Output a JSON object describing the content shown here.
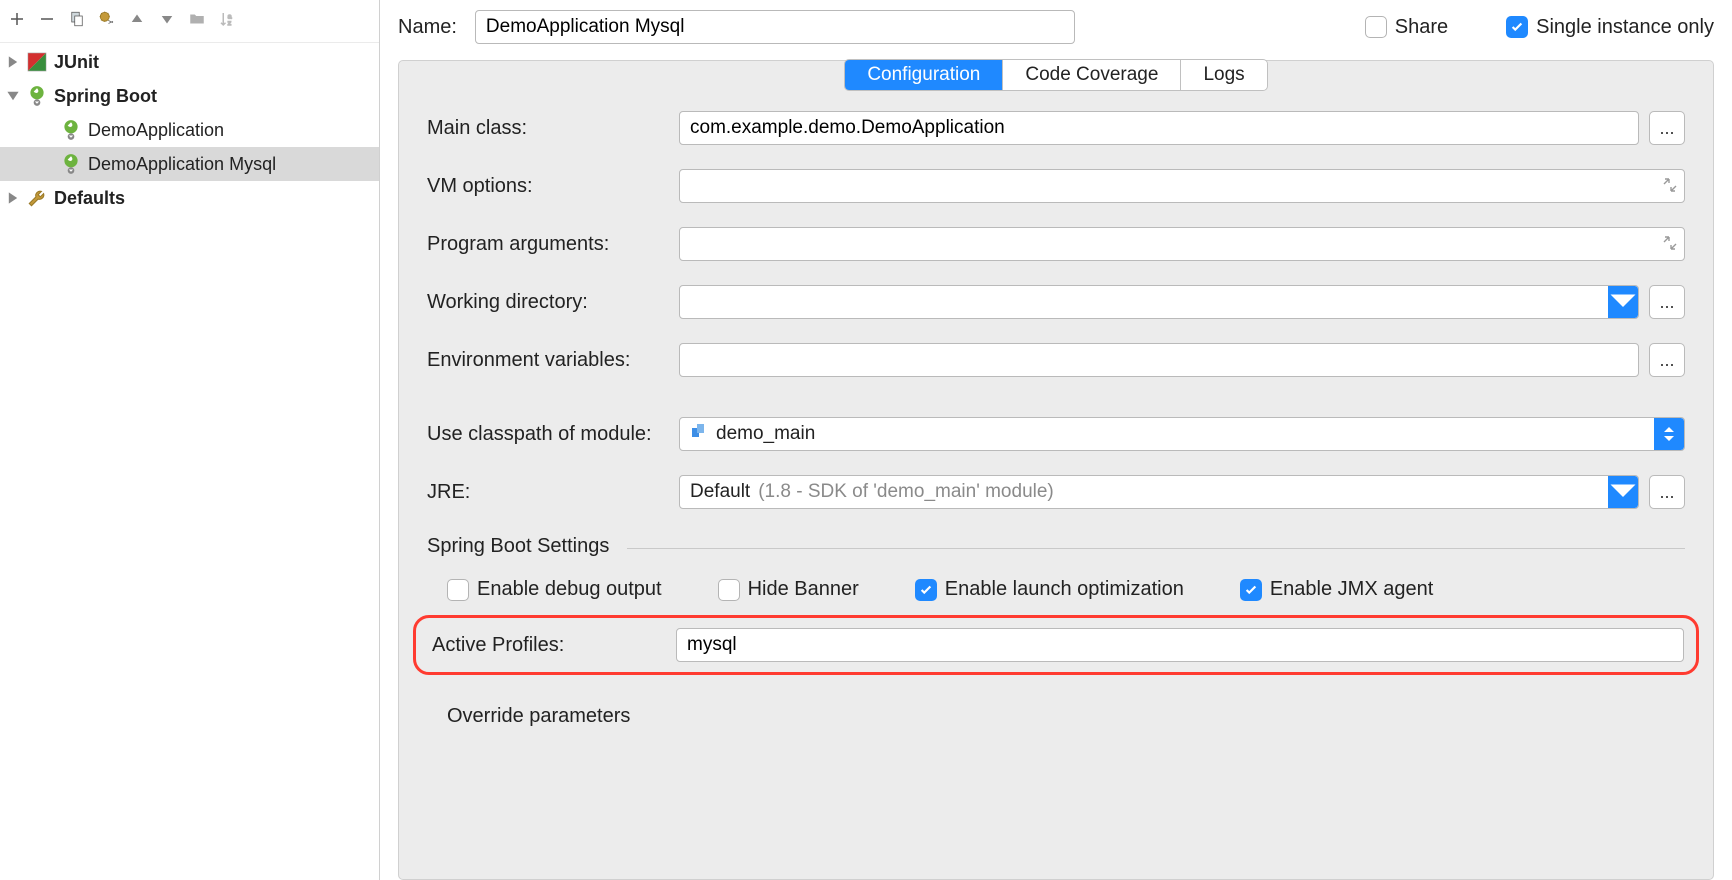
{
  "sidebar": {
    "items": [
      {
        "label": "JUnit",
        "icon": "junit",
        "expandable": true,
        "expanded": false,
        "indent": 0,
        "bold": true
      },
      {
        "label": "Spring Boot",
        "icon": "spring",
        "expandable": true,
        "expanded": true,
        "indent": 0,
        "bold": true
      },
      {
        "label": "DemoApplication",
        "icon": "spring",
        "expandable": false,
        "indent": 1
      },
      {
        "label": "DemoApplication Mysql",
        "icon": "spring",
        "expandable": false,
        "indent": 1,
        "selected": true
      },
      {
        "label": "Defaults",
        "icon": "defaults",
        "expandable": true,
        "expanded": false,
        "indent": 0,
        "bold": true
      }
    ]
  },
  "header": {
    "name_label": "Name:",
    "name_value": "DemoApplication Mysql",
    "share_label": "Share",
    "share_checked": false,
    "single_label": "Single instance only",
    "single_checked": true
  },
  "tabs": [
    "Configuration",
    "Code Coverage",
    "Logs"
  ],
  "active_tab": 0,
  "form": {
    "main_class_label": "Main class:",
    "main_class_value": "com.example.demo.DemoApplication",
    "vm_label": "VM options:",
    "args_label": "Program arguments:",
    "workdir_label": "Working directory:",
    "env_label": "Environment variables:",
    "classpath_label": "Use classpath of module:",
    "classpath_value": "demo_main",
    "jre_label": "JRE:",
    "jre_value": "Default ",
    "jre_hint": "(1.8 - SDK of 'demo_main' module)",
    "sb_section": "Spring Boot Settings",
    "sb_debug": "Enable debug output",
    "sb_hide": "Hide Banner",
    "sb_launch": "Enable launch optimization",
    "sb_jmx": "Enable JMX agent",
    "profiles_label": "Active Profiles:",
    "profiles_value": "mysql",
    "override_label": "Override parameters",
    "ellipsis": "..."
  }
}
